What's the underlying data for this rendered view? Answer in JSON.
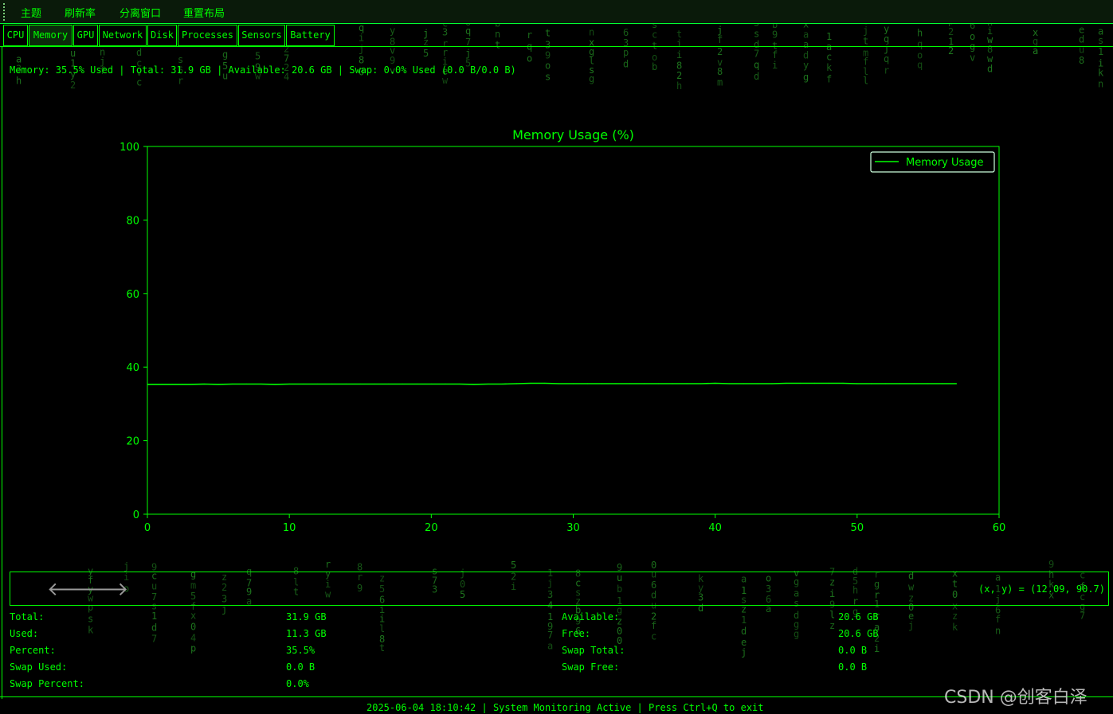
{
  "menubar": {
    "items": [
      "主题",
      "刷新率",
      "分离窗口",
      "重置布局"
    ]
  },
  "tabs": [
    "CPU",
    "Memory",
    "GPU",
    "Network",
    "Disk",
    "Processes",
    "Sensors",
    "Battery"
  ],
  "active_tab": "Memory",
  "summary": "Memory: 35.5% Used | Total: 31.9 GB | Available: 20.6 GB | Swap: 0.0% Used (0.0 B/0.0 B)",
  "chart_data": {
    "type": "line",
    "title": "Memory Usage (%)",
    "xlabel": "",
    "ylabel": "",
    "xlim": [
      0,
      60
    ],
    "ylim": [
      0,
      100
    ],
    "x_ticks": [
      0,
      10,
      20,
      30,
      40,
      50,
      60
    ],
    "y_ticks": [
      0,
      20,
      40,
      60,
      80,
      100
    ],
    "grid": false,
    "legend_position": "top-right",
    "series": [
      {
        "name": "Memory Usage",
        "color": "#00ff00",
        "x": [
          0,
          1,
          2,
          3,
          4,
          5,
          6,
          7,
          8,
          9,
          10,
          11,
          12,
          13,
          14,
          15,
          16,
          17,
          18,
          19,
          20,
          21,
          22,
          23,
          24,
          25,
          26,
          27,
          28,
          29,
          30,
          31,
          32,
          33,
          34,
          35,
          36,
          37,
          38,
          39,
          40,
          41,
          42,
          43,
          44,
          45,
          46,
          47,
          48,
          49,
          50,
          51,
          52,
          53,
          54,
          55,
          56,
          57
        ],
        "values": [
          35.3,
          35.3,
          35.3,
          35.3,
          35.4,
          35.3,
          35.4,
          35.4,
          35.4,
          35.3,
          35.4,
          35.4,
          35.4,
          35.4,
          35.4,
          35.4,
          35.4,
          35.4,
          35.4,
          35.4,
          35.4,
          35.4,
          35.4,
          35.3,
          35.4,
          35.4,
          35.5,
          35.6,
          35.6,
          35.5,
          35.5,
          35.5,
          35.5,
          35.5,
          35.5,
          35.5,
          35.5,
          35.5,
          35.5,
          35.5,
          35.6,
          35.5,
          35.5,
          35.5,
          35.5,
          35.6,
          35.6,
          35.6,
          35.6,
          35.6,
          35.5,
          35.5,
          35.5,
          35.5,
          35.5,
          35.5,
          35.5,
          35.5
        ]
      }
    ]
  },
  "toolbar": {
    "back_glyph": "🡐",
    "forward_glyph": "🡒",
    "coords": "(x, y) = (12.09, 90.7)"
  },
  "stats": {
    "left": [
      {
        "label": "Total:",
        "value": "31.9 GB"
      },
      {
        "label": "Used:",
        "value": "11.3 GB"
      },
      {
        "label": "Percent:",
        "value": "35.5%"
      },
      {
        "label": "Swap Used:",
        "value": "0.0 B"
      },
      {
        "label": "Swap Percent:",
        "value": "0.0%"
      }
    ],
    "right": [
      {
        "label": "Available:",
        "value": "20.6 GB"
      },
      {
        "label": "Free:",
        "value": "20.6 GB"
      },
      {
        "label": "Swap Total:",
        "value": "0.0 B"
      },
      {
        "label": "Swap Free:",
        "value": "0.0 B"
      }
    ]
  },
  "status": "2025-06-04 18:10:42 | System Monitoring Active | Press Ctrl+Q to exit",
  "watermark": "CSDN @创客白泽",
  "colors": {
    "accent": "#00ff00",
    "background": "#000000",
    "menubar_bg": "#0a1a0a",
    "rain": "#1f7a1f"
  }
}
